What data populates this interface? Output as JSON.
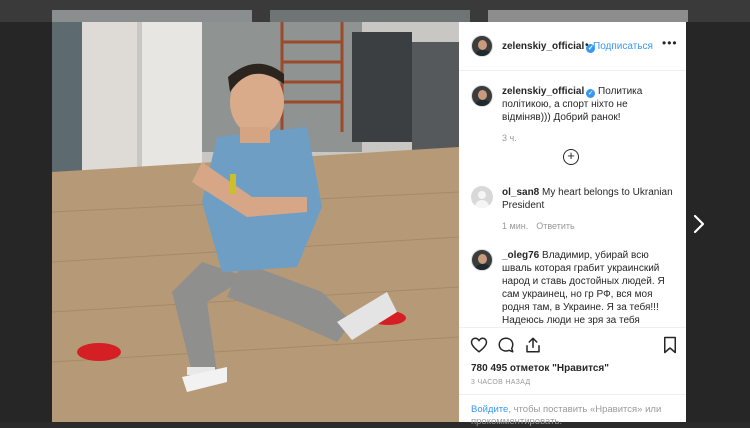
{
  "post": {
    "username": "zelenskiy_official",
    "follow_label": "Подписаться",
    "separator": "•",
    "more_icon": "more-horizontal-icon",
    "verified_icon": "verified-badge-icon"
  },
  "caption": {
    "username": "zelenskiy_official",
    "text": "Политика політикою, а спорт ніхто не відміняв))) Добрий ранок!",
    "time": "3 ч."
  },
  "load_more_icon": "plus-circle-icon",
  "comments": [
    {
      "username": "ol_san8",
      "text": "My heart belongs to Ukranian President",
      "time": "1 мин.",
      "reply_label": "Ответить"
    },
    {
      "username": "_oleg76",
      "text": "Владимир, убирай всю шваль которая грабит украинский народ и ставь достойных людей. Я сам украинец, но гр РФ, вся моя родня там, в Украине. Я за тебя!!! Надеюсь люди не зря за тебя"
    }
  ],
  "actions": {
    "likes": "780 495 отметок \"Нравится\"",
    "time_ago": "3 ЧАСОВ НАЗАД",
    "login_prefix": "Войдите",
    "login_suffix": ", чтобы поставить «Нравится» или прокомментировать."
  },
  "colors": {
    "accent": "#3897f0",
    "text": "#262626",
    "muted": "#999999"
  }
}
